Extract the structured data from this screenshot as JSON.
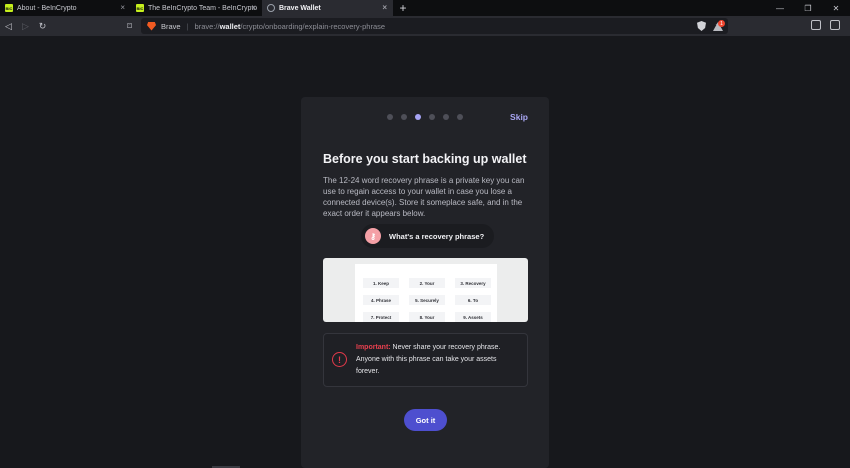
{
  "tabs": [
    {
      "title": "About - BeInCrypto",
      "favicon": "beincrypto-icon",
      "active": false
    },
    {
      "title": "The BeInCrypto Team - BeInCrypto",
      "favicon": "beincrypto-icon",
      "active": false
    },
    {
      "title": "Brave Wallet",
      "favicon": "globe-icon",
      "active": true
    }
  ],
  "tab_close_glyph": "×",
  "new_tab_glyph": "+",
  "window_controls": {
    "minimize": "—",
    "maximize": "❐",
    "close": "✕"
  },
  "toolbar": {
    "back": "◁",
    "forward": "▷",
    "reload": "↻",
    "bookmark": "⌑"
  },
  "urlbar": {
    "brand": "Brave",
    "scheme": "brave://",
    "host": "wallet",
    "path": "/crypto/onboarding/explain-recovery-phrase"
  },
  "rewards_badge": "1",
  "onboarding": {
    "step_count": 6,
    "active_step": 3,
    "skip_label": "Skip",
    "title": "Before you start backing up wallet",
    "description": "The 12-24 word recovery phrase is a private key you can use to regain access to your wallet in case you lose a connected device(s). Store it someplace safe, and in the exact order it appears below.",
    "help_pill": "What's a recovery phrase?",
    "sample_words": [
      "1. Keep",
      "2. Your",
      "3. Recovery",
      "4. Phrase",
      "5. Securely",
      "6. To",
      "7. Protect",
      "8. Your",
      "9. Assets"
    ],
    "warning_label": "Important:",
    "warning_text": " Never share your recovery phrase. Anyone with this phrase can take your assets forever.",
    "warning_glyph": "!",
    "cta_label": "Got it"
  },
  "colors": {
    "accent": "#4e4fcf",
    "danger": "#e2394a",
    "dot_active": "#a7a4f5"
  }
}
